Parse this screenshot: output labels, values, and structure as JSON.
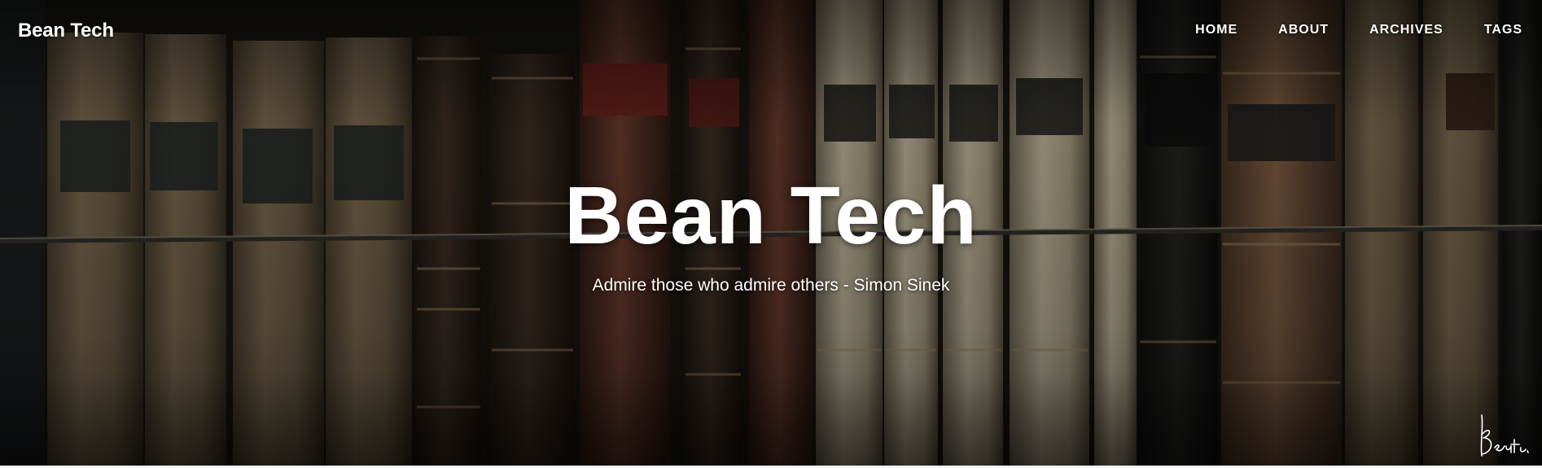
{
  "site": {
    "brand": "Bean Tech"
  },
  "nav": {
    "items": [
      {
        "label": "HOME"
      },
      {
        "label": "ABOUT"
      },
      {
        "label": "ARCHIVES"
      },
      {
        "label": "TAGS"
      }
    ]
  },
  "hero": {
    "title": "Bean Tech",
    "subtitle": "Admire those who admire others - Simon Sinek",
    "background": "old-books-on-shelf-image",
    "signature": "Beantech."
  },
  "colors": {
    "text": "#ffffff",
    "overlay": "#1c1b18"
  }
}
